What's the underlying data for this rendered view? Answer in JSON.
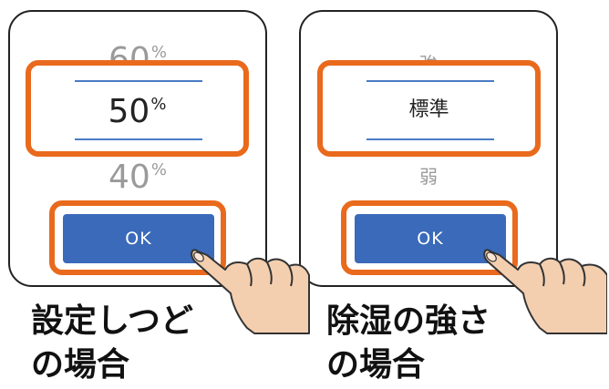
{
  "left_panel": {
    "upper_value": "60",
    "selected_value": "50",
    "lower_value": "40",
    "unit": "%",
    "ok_label": "OK",
    "caption_line1": "設定しつど",
    "caption_line2": "の場合"
  },
  "right_panel": {
    "upper_value": "強",
    "selected_value": "標準",
    "lower_value": "弱",
    "ok_label": "OK",
    "caption_line1": "除湿の強さ",
    "caption_line2": "の場合"
  },
  "colors": {
    "highlight": "#e96a1c",
    "button": "#3a6ab9",
    "divider": "#4a7cc6"
  },
  "icons": [
    "tapping-hand-icon",
    "tapping-hand-icon"
  ]
}
